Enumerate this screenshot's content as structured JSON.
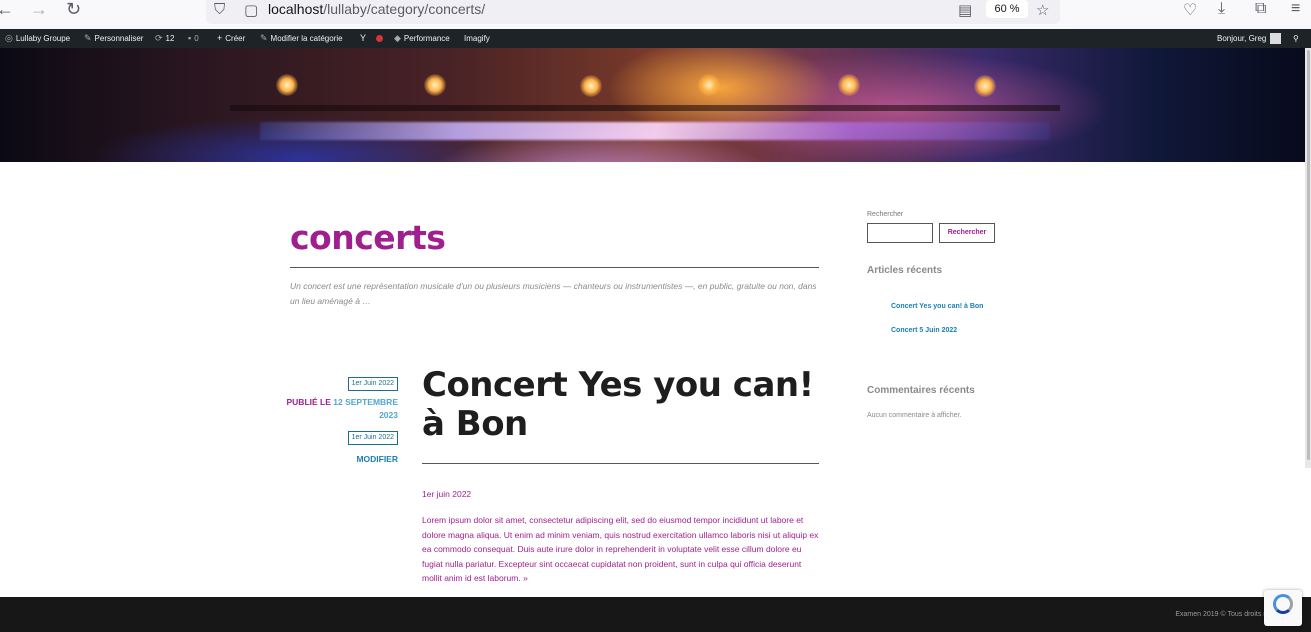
{
  "browser": {
    "url_host": "localhost",
    "url_path": "/lullaby/category/concerts/",
    "zoom": "60 %",
    "back_icon": "back-arrow-icon",
    "forward_icon": "forward-arrow-icon",
    "reload_icon": "reload-icon"
  },
  "adminbar": {
    "site": "Lullaby Groupe",
    "customize": "Personnaliser",
    "updates_count": "12",
    "comments_count": "0",
    "new": "Créer",
    "edit_category": "Modifier la catégorie",
    "performance": "Performance",
    "imagify": "Imagify",
    "greeting": "Bonjour, Greg"
  },
  "archive": {
    "title": "concerts",
    "description": "Un concert est une représentation musicale d'un ou plusieurs musiciens — chanteurs ou instrumentistes —, en public, gratuite ou non, dans un lieu aménagé à …"
  },
  "post": {
    "date_badge": "1er Juin 2022",
    "published_label": "PUBLIÉ LE",
    "published_value": "12 SEPTEMBRE 2023",
    "date_badge_2": "1er Juin 2022",
    "edit_label": "MODIFIER",
    "title": "Concert Yes you can! à Bon",
    "date_line": "1er juin 2022",
    "excerpt": "Lorem ipsum dolor sit amet, consectetur adipiscing elit, sed do eiusmod tempor incididunt ut labore et dolore magna aliqua. Ut enim ad minim veniam, quis nostrud exercitation ullamco laboris nisi ut aliquip ex ea commodo consequat. Duis aute irure dolor in reprehenderit in voluptate velit esse cillum dolore eu fugiat nulla pariatur. Excepteur sint occaecat cupidatat non proident, sunt in culpa qui officia deserunt mollit anim id est laborum. »"
  },
  "sidebar": {
    "search_label": "Rechercher",
    "search_value": "",
    "search_button": "Rechercher",
    "recent_posts_heading": "Articles récents",
    "recent_posts": [
      "Concert Yes you can! à Bon",
      "Concert 5 Juin 2022"
    ],
    "recent_comments_heading": "Commentaires récents",
    "no_comments": "Aucun commentaire à afficher."
  },
  "footer": {
    "text": "Examen 2019 © Tous droits rés"
  },
  "colors": {
    "brand_magenta": "#a01f8e",
    "link_blue": "#1b7fb5",
    "adminbar_bg": "#1d2327",
    "footer_bg": "#171717"
  }
}
